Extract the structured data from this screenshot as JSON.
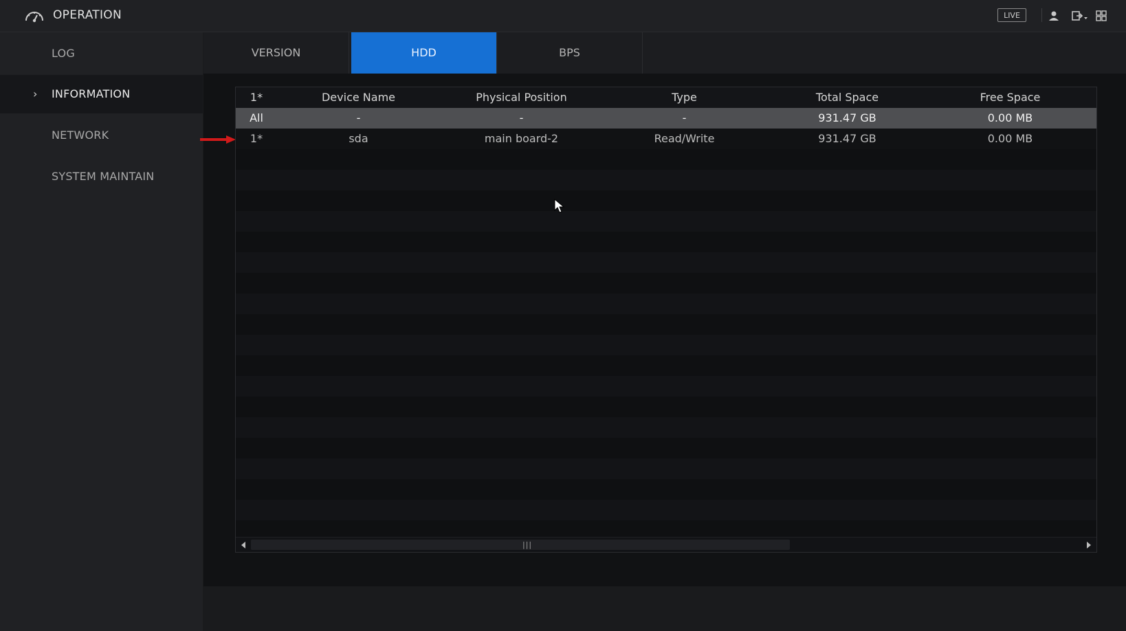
{
  "app": {
    "title": "OPERATION",
    "icon": "gauge-icon"
  },
  "topbar": {
    "live_label": "LIVE",
    "icons": [
      "user-icon",
      "logout-icon",
      "grid-icon"
    ]
  },
  "sidebar": {
    "items": [
      {
        "label": "LOG",
        "active": false
      },
      {
        "label": "INFORMATION",
        "active": true
      },
      {
        "label": "NETWORK",
        "active": false
      },
      {
        "label": "SYSTEM MAINTAIN",
        "active": false
      }
    ]
  },
  "tabs": [
    {
      "label": "VERSION",
      "active": false
    },
    {
      "label": "HDD",
      "active": true
    },
    {
      "label": "BPS",
      "active": false
    }
  ],
  "table": {
    "columns": [
      "1*",
      "Device Name",
      "Physical Position",
      "Type",
      "Total Space",
      "Free Space"
    ],
    "rows": [
      [
        "All",
        "-",
        "-",
        "-",
        "931.47 GB",
        "0.00 MB"
      ],
      [
        "1*",
        "sda",
        "main board-2",
        "Read/Write",
        "931.47 GB",
        "0.00 MB"
      ]
    ],
    "selected_row": 0
  },
  "colors": {
    "accent": "#1670d4",
    "annotation_arrow": "#d11a1a"
  }
}
